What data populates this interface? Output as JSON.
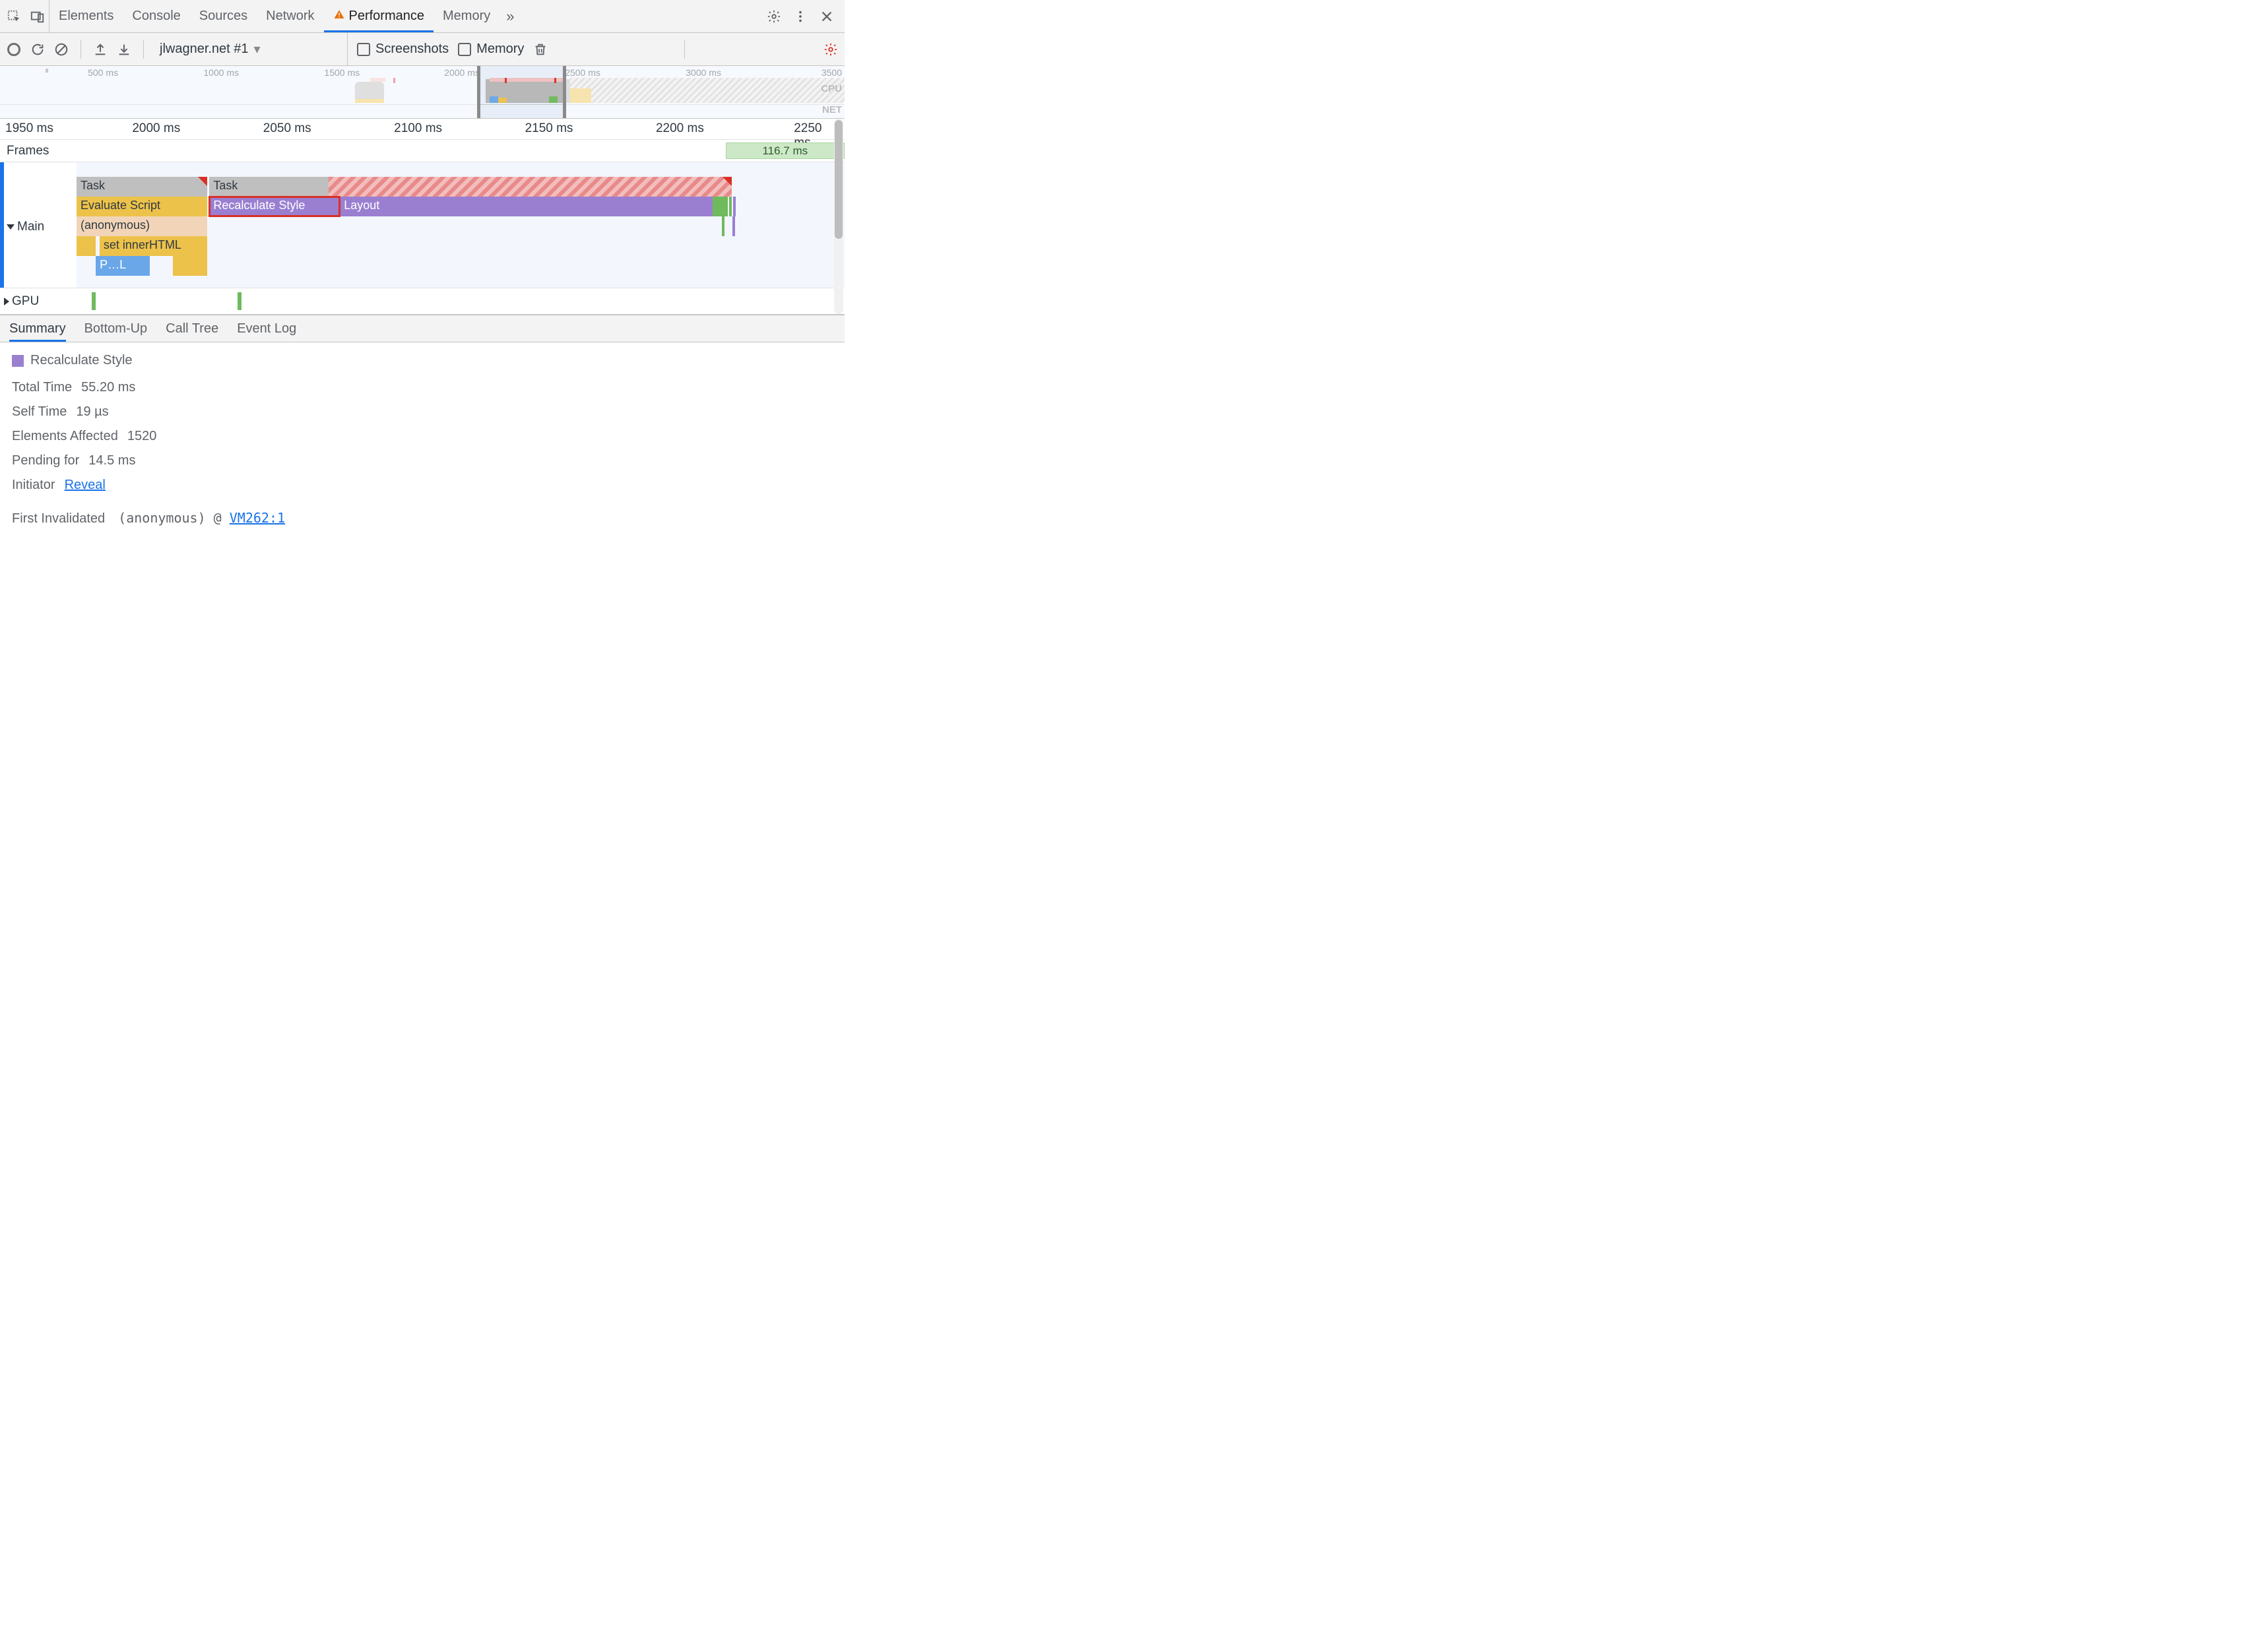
{
  "tabs": {
    "items": [
      "Elements",
      "Console",
      "Sources",
      "Network",
      "Performance",
      "Memory"
    ],
    "active": "Performance",
    "more": "»"
  },
  "perf_toolbar": {
    "recording_select": "jlwagner.net #1",
    "screenshots_label": "Screenshots",
    "memory_label": "Memory"
  },
  "overview": {
    "ticks": [
      "500 ms",
      "1000 ms",
      "1500 ms",
      "2000 ms",
      "2500 ms",
      "3000 ms",
      "3500"
    ],
    "cpu_label": "CPU",
    "net_label": "NET",
    "selection_start_ms": 2020,
    "selection_end_ms": 2380
  },
  "time_ruler": [
    "1950 ms",
    "2000 ms",
    "2050 ms",
    "2100 ms",
    "2150 ms",
    "2200 ms",
    "2250 ms"
  ],
  "frames": {
    "label": "Frames",
    "chip": "116.7 ms"
  },
  "main": {
    "label": "Main",
    "row0_task1": "Task",
    "row0_task2": "Task",
    "row1_eval": "Evaluate Script",
    "row1_recalc": "Recalculate Style",
    "row1_layout": "Layout",
    "row2_anon": "(anonymous)",
    "row3_setinner": "set innerHTML",
    "row4_partial": "P…L"
  },
  "gpu": {
    "label": "GPU"
  },
  "bottom_tabs": [
    "Summary",
    "Bottom-Up",
    "Call Tree",
    "Event Log"
  ],
  "summary": {
    "title": "Recalculate Style",
    "rows": {
      "total_time_k": "Total Time",
      "total_time_v": "55.20 ms",
      "self_time_k": "Self Time",
      "self_time_v": "19 µs",
      "elements_k": "Elements Affected",
      "elements_v": "1520",
      "pending_k": "Pending for",
      "pending_v": "14.5 ms",
      "initiator_k": "Initiator",
      "initiator_link": "Reveal",
      "first_inv_k": "First Invalidated",
      "first_inv_fn": "(anonymous)",
      "first_inv_at": "@",
      "first_inv_loc": "VM262:1"
    }
  },
  "colors": {
    "purple": "#9a7fd1",
    "yellow": "#edc24a",
    "green": "#6fba5c",
    "blue": "#6aa7e8",
    "task_gray": "#bfbfbf",
    "hatch_red": "#e88a8a",
    "accent": "#1a73e8",
    "danger": "#d93025"
  }
}
